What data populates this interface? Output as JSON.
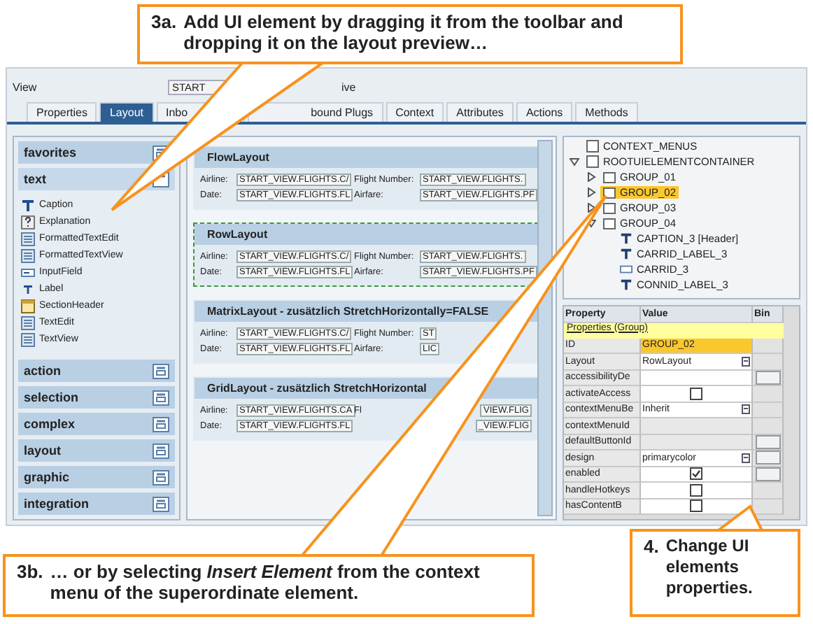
{
  "callouts": [
    {
      "kind": "top",
      "number": "3a.",
      "text": "Add UI element by dragging it from the toolbar and dropping it on the layout preview…"
    },
    {
      "kind": "bottom-left",
      "number": "3b.",
      "text": "… or by selecting *Insert Element* from the context menu of the superordinate element."
    },
    {
      "kind": "bottom-right",
      "number": "4.",
      "text": "Change UI elements properties."
    }
  ],
  "view": {
    "label": "View",
    "value": "START",
    "description": "ive"
  },
  "tabs": [
    {
      "label": "Properties",
      "selected": false
    },
    {
      "label": "Layout",
      "selected": true
    },
    {
      "label": "Inbo",
      "selected": false
    },
    {
      "label": "bound Plugs",
      "selected": false
    },
    {
      "label": "Context",
      "selected": false
    },
    {
      "label": "Attributes",
      "selected": false
    },
    {
      "label": "Actions",
      "selected": false
    },
    {
      "label": "Methods",
      "selected": false
    }
  ],
  "palette": [
    {
      "label": "favorites",
      "expanded": false
    },
    {
      "label": "text",
      "expanded": true,
      "items": [
        {
          "label": "Caption",
          "kind": "caption"
        },
        {
          "label": "Explanation",
          "kind": "help"
        },
        {
          "label": "FormattedTextEdit",
          "kind": "textarea"
        },
        {
          "label": "FormattedTextView",
          "kind": "textarea"
        },
        {
          "label": "InputField",
          "kind": "input"
        },
        {
          "label": "Label",
          "kind": "label"
        },
        {
          "label": "SectionHeader",
          "kind": "header"
        },
        {
          "label": "TextEdit",
          "kind": "textarea"
        },
        {
          "label": "TextView",
          "kind": "textarea"
        }
      ]
    },
    {
      "label": "action",
      "expanded": false
    },
    {
      "label": "selection",
      "expanded": false
    },
    {
      "label": "complex",
      "expanded": false
    },
    {
      "label": "layout",
      "expanded": false
    },
    {
      "label": "graphic",
      "expanded": false
    },
    {
      "label": "integration",
      "expanded": false
    }
  ],
  "preview": [
    {
      "title": "FlowLayout",
      "kind": "flow",
      "selected": false,
      "rows": [
        [
          {
            "label": "Airline:",
            "value": "START_VIEW.FLIGHTS.C/"
          },
          {
            "label": "Flight Number:",
            "value": "START_VIEW.FLIGHTS."
          }
        ],
        [
          {
            "label": "Date:",
            "value": "START_VIEW.FLIGHTS.FL"
          },
          {
            "label": "Airfare:",
            "value": "START_VIEW.FLIGHTS.PF"
          }
        ]
      ]
    },
    {
      "title": "RowLayout",
      "kind": "row",
      "selected": true,
      "rows": [
        [
          {
            "label": "Airline:",
            "value": "START_VIEW.FLIGHTS.C/"
          },
          {
            "label": "Flight Number:",
            "value": "START_VIEW.FLIGHTS."
          }
        ],
        [
          {
            "label": "Date:",
            "value": "START_VIEW.FLIGHTS.FL"
          },
          {
            "label": "Airfare:",
            "value": "START_VIEW.FLIGHTS.PF"
          }
        ]
      ]
    },
    {
      "title": "MatrixLayout - zusätzlich StretchHorizontally=FALSE",
      "kind": "matrix",
      "selected": false,
      "rows": [
        [
          {
            "label": "Airline:",
            "value": "START_VIEW.FLIGHTS.C/"
          },
          {
            "label": "Flight Number:",
            "value": "ST"
          }
        ],
        [
          {
            "label": "Date:",
            "value": "START_VIEW.FLIGHTS.FL"
          },
          {
            "label": "Airfare:",
            "value": "LIC"
          }
        ]
      ]
    },
    {
      "title": "GridLayout - zusätzlich StretchHorizontal",
      "kind": "grid",
      "selected": false,
      "rows": [
        [
          {
            "label": "Airline:",
            "value": "START_VIEW.FLIGHTS.CA"
          },
          {
            "label": "Fl",
            "value": "VIEW.FLIG"
          }
        ],
        [
          {
            "label": "Date:",
            "value": "START_VIEW.FLIGHTS.FL"
          },
          {
            "value": "_VIEW.FLIG"
          }
        ]
      ]
    }
  ],
  "tree": [
    {
      "label": "CONTEXT_MENUS",
      "kind": "node",
      "selected": false
    },
    {
      "label": "ROOTUIELEMENTCONTAINER",
      "kind": "node",
      "selected": false,
      "expanded": true,
      "children": [
        {
          "label": "GROUP_01",
          "kind": "group",
          "selected": false,
          "expanded": false
        },
        {
          "label": "GROUP_02",
          "kind": "group",
          "selected": true,
          "expanded": false
        },
        {
          "label": "GROUP_03",
          "kind": "group",
          "selected": false,
          "expanded": false
        },
        {
          "label": "GROUP_04",
          "kind": "group",
          "selected": false,
          "expanded": true,
          "children": [
            {
              "label": "CAPTION_3 [Header]",
              "kind": "caption",
              "selected": false
            },
            {
              "label": "CARRID_LABEL_3",
              "kind": "label",
              "selected": false
            },
            {
              "label": "CARRID_3",
              "kind": "input",
              "selected": false
            },
            {
              "label": "CONNID_LABEL_3",
              "kind": "label",
              "selected": false
            }
          ]
        }
      ]
    }
  ],
  "properties": {
    "columns": [
      "Property",
      "Value",
      "Bin"
    ],
    "section": "Properties (Group)",
    "rows": [
      {
        "name": "ID",
        "kind": "text",
        "value": "GROUP_02",
        "selected": true,
        "bind": false
      },
      {
        "name": "Layout",
        "kind": "dropdown",
        "value": "RowLayout",
        "selected": false,
        "bind": false
      },
      {
        "name": "accessibilityDe",
        "kind": "text",
        "selected": false,
        "bind": true
      },
      {
        "name": "activateAccess",
        "kind": "checkbox",
        "checked": false,
        "selected": false,
        "bind": false
      },
      {
        "name": "contextMenuBe",
        "kind": "dropdown",
        "value": "Inherit",
        "selected": false,
        "bind": false
      },
      {
        "name": "contextMenuId",
        "kind": "readonly",
        "selected": false,
        "bind": false
      },
      {
        "name": "defaultButtonId",
        "kind": "readonly",
        "selected": false,
        "bind": true
      },
      {
        "name": "design",
        "kind": "dropdown",
        "value": "primarycolor",
        "selected": false,
        "bind": true
      },
      {
        "name": "enabled",
        "kind": "checkbox",
        "checked": true,
        "selected": false,
        "bind": true
      },
      {
        "name": "handleHotkeys",
        "kind": "checkbox",
        "checked": false,
        "selected": false,
        "bind": false
      },
      {
        "name": "hasContentB",
        "kind": "checkbox",
        "checked": false,
        "selected": false,
        "bind": false
      }
    ]
  }
}
